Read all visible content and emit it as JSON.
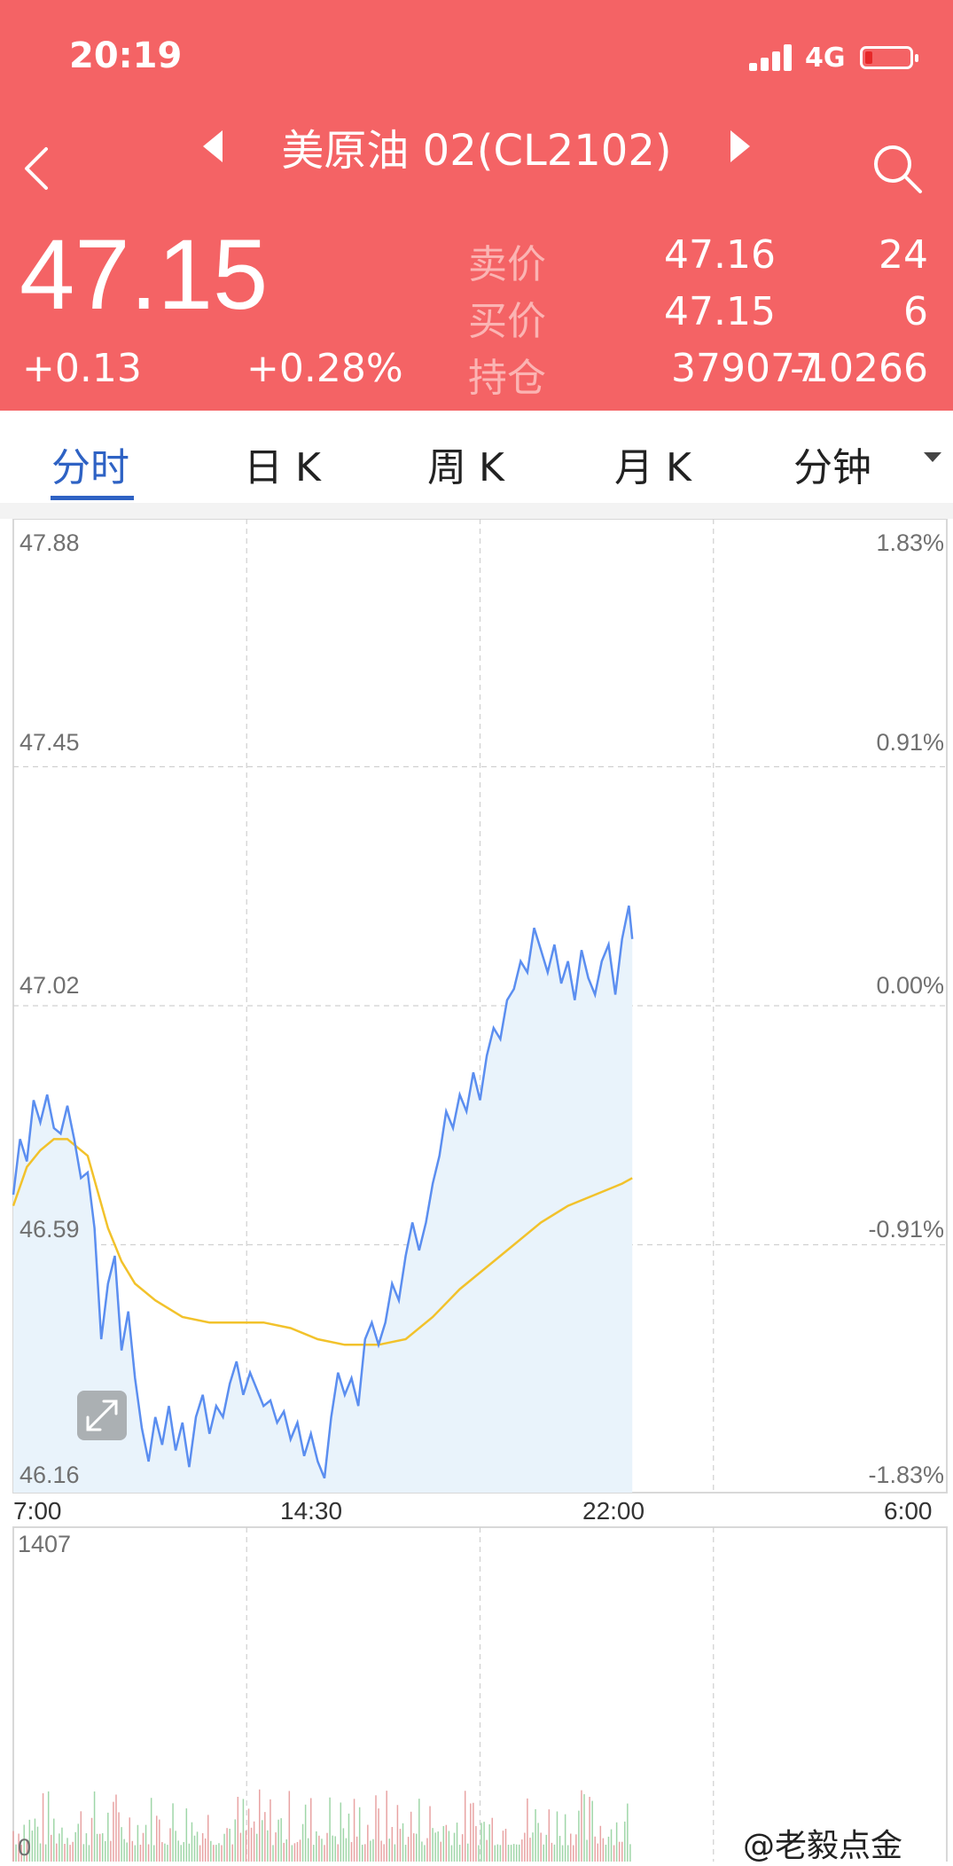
{
  "status": {
    "time": "20:19",
    "network": "4G"
  },
  "header": {
    "title": "美原油 02(CL2102)",
    "price": "47.15",
    "change": "+0.13",
    "change_pct": "+0.28%"
  },
  "quotes": [
    {
      "label": "卖价",
      "value": "47.16",
      "volume": "24"
    },
    {
      "label": "买价",
      "value": "47.15",
      "volume": "6"
    },
    {
      "label": "持仓",
      "value": "379077",
      "volume": "-10266"
    }
  ],
  "tabs": [
    {
      "label": "分时",
      "active": true
    },
    {
      "label": "日 K",
      "active": false
    },
    {
      "label": "周 K",
      "active": false
    },
    {
      "label": "月 K",
      "active": false
    },
    {
      "label": "分钟",
      "active": false
    }
  ],
  "chart_data": {
    "type": "line",
    "y_left": [
      "47.88",
      "47.45",
      "47.02",
      "46.59",
      "46.16"
    ],
    "y_right": [
      "1.83%",
      "0.91%",
      "0.00%",
      "-0.91%",
      "-1.83%"
    ],
    "x_ticks": [
      "7:00",
      "14:30",
      "22:00",
      "6:00"
    ],
    "ylim": [
      46.16,
      47.88
    ],
    "x_range": [
      0,
      1380
    ],
    "price_series": [
      [
        0,
        46.68
      ],
      [
        10,
        46.78
      ],
      [
        20,
        46.74
      ],
      [
        30,
        46.85
      ],
      [
        40,
        46.81
      ],
      [
        50,
        46.86
      ],
      [
        60,
        46.8
      ],
      [
        70,
        46.79
      ],
      [
        80,
        46.84
      ],
      [
        90,
        46.78
      ],
      [
        100,
        46.71
      ],
      [
        110,
        46.72
      ],
      [
        120,
        46.62
      ],
      [
        130,
        46.42
      ],
      [
        140,
        46.52
      ],
      [
        150,
        46.57
      ],
      [
        160,
        46.4
      ],
      [
        170,
        46.47
      ],
      [
        180,
        46.35
      ],
      [
        190,
        46.26
      ],
      [
        200,
        46.2
      ],
      [
        210,
        46.28
      ],
      [
        220,
        46.23
      ],
      [
        230,
        46.3
      ],
      [
        240,
        46.22
      ],
      [
        250,
        46.27
      ],
      [
        260,
        46.19
      ],
      [
        270,
        46.28
      ],
      [
        280,
        46.32
      ],
      [
        290,
        46.25
      ],
      [
        300,
        46.3
      ],
      [
        310,
        46.28
      ],
      [
        320,
        46.34
      ],
      [
        330,
        46.38
      ],
      [
        340,
        46.32
      ],
      [
        350,
        46.36
      ],
      [
        360,
        46.33
      ],
      [
        370,
        46.3
      ],
      [
        380,
        46.31
      ],
      [
        390,
        46.27
      ],
      [
        400,
        46.29
      ],
      [
        410,
        46.24
      ],
      [
        420,
        46.27
      ],
      [
        430,
        46.21
      ],
      [
        440,
        46.25
      ],
      [
        450,
        46.2
      ],
      [
        460,
        46.17
      ],
      [
        470,
        46.28
      ],
      [
        480,
        46.36
      ],
      [
        490,
        46.32
      ],
      [
        500,
        46.35
      ],
      [
        510,
        46.3
      ],
      [
        520,
        46.42
      ],
      [
        530,
        46.45
      ],
      [
        540,
        46.41
      ],
      [
        550,
        46.45
      ],
      [
        560,
        46.52
      ],
      [
        570,
        46.49
      ],
      [
        580,
        46.57
      ],
      [
        590,
        46.63
      ],
      [
        600,
        46.58
      ],
      [
        610,
        46.63
      ],
      [
        620,
        46.7
      ],
      [
        630,
        46.75
      ],
      [
        640,
        46.83
      ],
      [
        650,
        46.8
      ],
      [
        660,
        46.86
      ],
      [
        670,
        46.83
      ],
      [
        680,
        46.9
      ],
      [
        690,
        46.85
      ],
      [
        700,
        46.93
      ],
      [
        710,
        46.98
      ],
      [
        720,
        46.96
      ],
      [
        730,
        47.03
      ],
      [
        740,
        47.05
      ],
      [
        750,
        47.1
      ],
      [
        760,
        47.08
      ],
      [
        770,
        47.16
      ],
      [
        780,
        47.12
      ],
      [
        790,
        47.08
      ],
      [
        800,
        47.13
      ],
      [
        810,
        47.06
      ],
      [
        820,
        47.1
      ],
      [
        830,
        47.03
      ],
      [
        840,
        47.12
      ],
      [
        850,
        47.07
      ],
      [
        860,
        47.04
      ],
      [
        870,
        47.1
      ],
      [
        880,
        47.13
      ],
      [
        890,
        47.04
      ],
      [
        900,
        47.14
      ],
      [
        910,
        47.2
      ],
      [
        915,
        47.14
      ]
    ],
    "avg_series": [
      [
        0,
        46.66
      ],
      [
        20,
        46.73
      ],
      [
        40,
        46.76
      ],
      [
        60,
        46.78
      ],
      [
        80,
        46.78
      ],
      [
        110,
        46.75
      ],
      [
        140,
        46.62
      ],
      [
        160,
        46.56
      ],
      [
        180,
        46.52
      ],
      [
        210,
        46.49
      ],
      [
        250,
        46.46
      ],
      [
        290,
        46.45
      ],
      [
        330,
        46.45
      ],
      [
        370,
        46.45
      ],
      [
        410,
        46.44
      ],
      [
        450,
        46.42
      ],
      [
        490,
        46.41
      ],
      [
        540,
        46.41
      ],
      [
        580,
        46.42
      ],
      [
        620,
        46.46
      ],
      [
        660,
        46.51
      ],
      [
        700,
        46.55
      ],
      [
        740,
        46.59
      ],
      [
        780,
        46.63
      ],
      [
        820,
        46.66
      ],
      [
        860,
        46.68
      ],
      [
        900,
        46.7
      ],
      [
        915,
        46.71
      ]
    ],
    "volume_max": "1407",
    "volume_min": "0"
  },
  "watermark": "@老毅点金",
  "colors": {
    "header_bg": "#f46365",
    "accent": "#2e62c4",
    "price_line": "#5b8ef0",
    "avg_line": "#f2c22b"
  }
}
